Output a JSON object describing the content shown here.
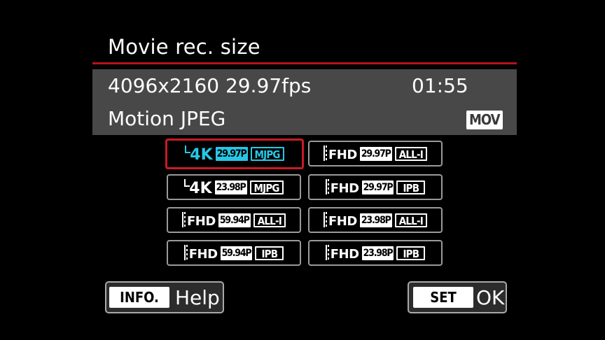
{
  "screen": {
    "title": "Movie rec. size"
  },
  "current": {
    "resolution": "4096x2160 29.97fps",
    "remaining_time": "01:55",
    "codec": "Motion JPEG",
    "container_badge": "MOV"
  },
  "options": [
    {
      "size": "4K",
      "fps": "29.97P",
      "compression": "MJPG",
      "selected": true
    },
    {
      "size": "FHD",
      "fps": "29.97P",
      "compression": "ALL-I",
      "selected": false
    },
    {
      "size": "4K",
      "fps": "23.98P",
      "compression": "MJPG",
      "selected": false
    },
    {
      "size": "FHD",
      "fps": "29.97P",
      "compression": "IPB",
      "selected": false
    },
    {
      "size": "FHD",
      "fps": "59.94P",
      "compression": "ALL-I",
      "selected": false
    },
    {
      "size": "FHD",
      "fps": "23.98P",
      "compression": "ALL-I",
      "selected": false
    },
    {
      "size": "FHD",
      "fps": "59.94P",
      "compression": "IPB",
      "selected": false
    },
    {
      "size": "FHD",
      "fps": "23.98P",
      "compression": "IPB",
      "selected": false
    }
  ],
  "footer": {
    "info_key": "INFO.",
    "info_label": "Help",
    "set_key": "SET",
    "set_label": "OK"
  },
  "colors": {
    "accent_red": "#c81b27",
    "selection_cyan": "#26c7e6",
    "panel_gray": "#484848"
  }
}
